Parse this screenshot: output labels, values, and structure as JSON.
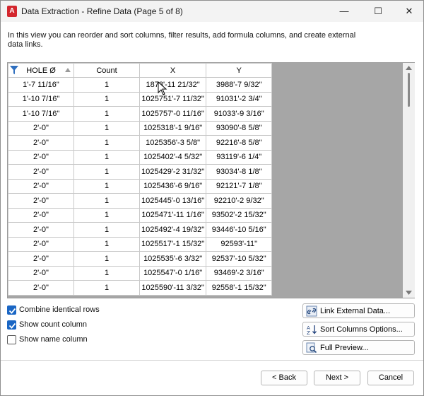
{
  "window": {
    "title": "Data Extraction - Refine Data (Page 5 of 8)",
    "icon_letter": "A",
    "minimize_glyph": "—",
    "maximize_glyph": "☐",
    "close_glyph": "✕"
  },
  "intro_text": "In this view you can reorder and sort columns, filter results, add formula columns, and create external data links.",
  "grid": {
    "columns": [
      "HOLE Ø",
      "Count",
      "X",
      "Y"
    ],
    "rows": [
      [
        "1'-7 11/16\"",
        "1",
        "1878'-11 21/32\"",
        "3988'-7 9/32\""
      ],
      [
        "1'-10 7/16\"",
        "1",
        "1025751'-7 11/32\"",
        "91031'-2 3/4\""
      ],
      [
        "1'-10 7/16\"",
        "1",
        "1025757'-0 11/16\"",
        "91033'-9 3/16\""
      ],
      [
        "2'-0\"",
        "1",
        "1025318'-1 9/16\"",
        "93090'-8 5/8\""
      ],
      [
        "2'-0\"",
        "1",
        "1025356'-3 5/8\"",
        "92216'-8 5/8\""
      ],
      [
        "2'-0\"",
        "1",
        "1025402'-4 5/32\"",
        "93119'-6 1/4\""
      ],
      [
        "2'-0\"",
        "1",
        "1025429'-2 31/32\"",
        "93034'-8 1/8\""
      ],
      [
        "2'-0\"",
        "1",
        "1025436'-6 9/16\"",
        "92121'-7 1/8\""
      ],
      [
        "2'-0\"",
        "1",
        "1025445'-0 13/16\"",
        "92210'-2 9/32\""
      ],
      [
        "2'-0\"",
        "1",
        "1025471'-11 1/16\"",
        "93502'-2 15/32\""
      ],
      [
        "2'-0\"",
        "1",
        "1025492'-4 19/32\"",
        "93446'-10 5/16\""
      ],
      [
        "2'-0\"",
        "1",
        "1025517'-1 15/32\"",
        "92593'-11\""
      ],
      [
        "2'-0\"",
        "1",
        "1025535'-6 3/32\"",
        "92537'-10 5/32\""
      ],
      [
        "2'-0\"",
        "1",
        "1025547'-0 1/16\"",
        "93469'-2 3/16\""
      ],
      [
        "2'-0\"",
        "1",
        "1025590'-11 3/32\"",
        "92558'-1 15/32\""
      ]
    ]
  },
  "options": {
    "combine_identical_rows": {
      "label": "Combine identical rows",
      "checked": true
    },
    "show_count_column": {
      "label": "Show count column",
      "checked": true
    },
    "show_name_column": {
      "label": "Show name column",
      "checked": false
    }
  },
  "side_buttons": {
    "link_external_data": "Link External Data...",
    "sort_columns_options": "Sort Columns Options...",
    "full_preview": "Full Preview..."
  },
  "footer": {
    "back": "< Back",
    "next": "Next >",
    "cancel": "Cancel"
  },
  "colors": {
    "checkbox_accent": "#1a66c4",
    "app_icon": "#d3262d",
    "grid_background": "#a6a6a6"
  }
}
